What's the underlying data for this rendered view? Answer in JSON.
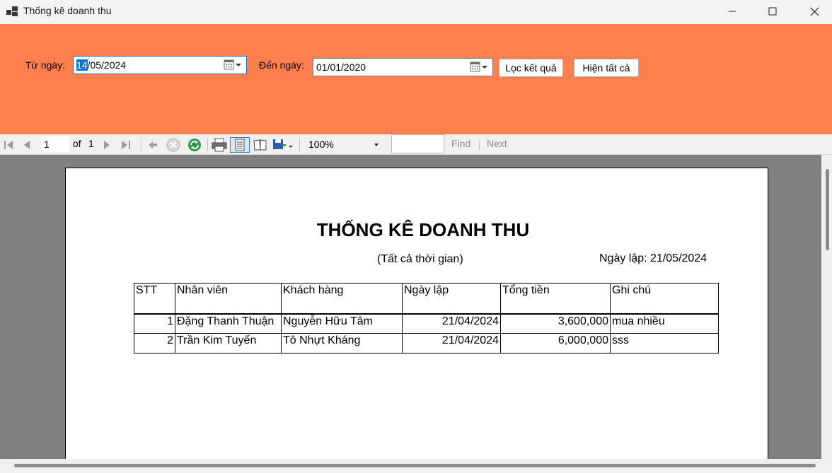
{
  "window": {
    "title": "Thống kê doanh thu",
    "icon": "app-window-icon"
  },
  "filter": {
    "from_label": "Từ ngày:",
    "from_value_selected": "14",
    "from_value_rest": "/05/2024",
    "to_label": "Đến ngày:",
    "to_value": "01/01/2020",
    "filter_button": "Lọc kết quả",
    "show_all_button": "Hiện tất cả",
    "panel_color": "#ff7f4f"
  },
  "toolbar": {
    "page_number": "1",
    "of_label": "of",
    "total_pages": "1",
    "zoom": "100%",
    "find_label": "Find",
    "next_label": "Next"
  },
  "report": {
    "title": "THỐNG KÊ DOANH THU",
    "subtitle": "(Tất cả thời gian)",
    "created_date": "Ngày lập: 21/05/2024",
    "columns": [
      "STT",
      "Nhân viên",
      "Khách hàng",
      "Ngày lập",
      "Tổng tiền",
      "Ghi chú"
    ],
    "rows": [
      [
        "1",
        "Đặng Thanh Thuận",
        "Nguyễn Hữu Tâm",
        "21/04/2024",
        "3,600,000",
        "mua nhiều"
      ],
      [
        "2",
        "Trần Kim Tuyến",
        "Tô Nhựt Kháng",
        "21/04/2024",
        "6,000,000",
        "sss"
      ]
    ]
  }
}
